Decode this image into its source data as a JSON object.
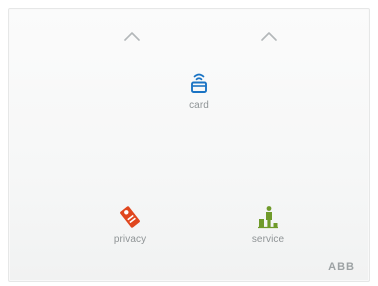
{
  "panel": {
    "chevrons": [
      {
        "icon": "chevron-up-icon"
      },
      {
        "icon": "chevron-up-icon"
      }
    ],
    "keys": {
      "card": {
        "label": "card",
        "icon": "card-reader-icon",
        "color": "#1b74c4"
      },
      "privacy": {
        "label": "privacy",
        "icon": "do-not-disturb-tag-icon",
        "color": "#e0461e"
      },
      "service": {
        "label": "service",
        "icon": "housekeeping-service-icon",
        "color": "#6f9a2a"
      }
    },
    "brand": "ABB"
  }
}
